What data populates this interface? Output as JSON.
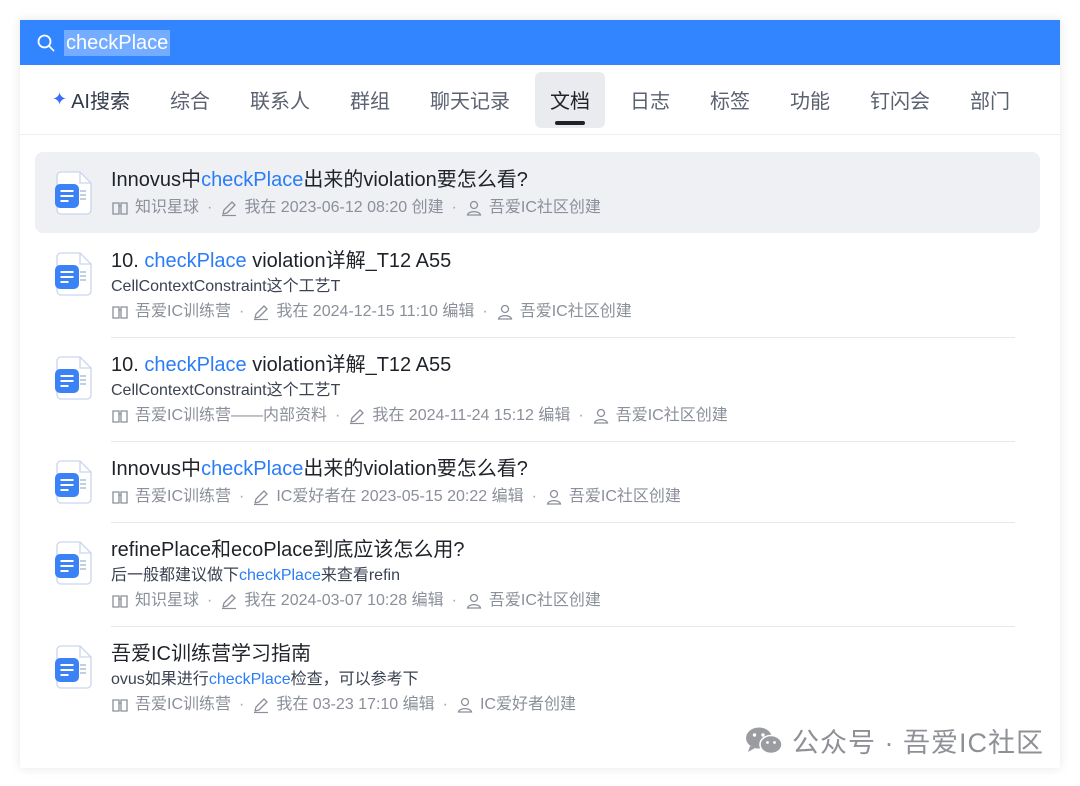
{
  "search": {
    "query": "checkPlace"
  },
  "tabs": [
    {
      "label": "AI搜索"
    },
    {
      "label": "综合"
    },
    {
      "label": "联系人"
    },
    {
      "label": "群组"
    },
    {
      "label": "聊天记录"
    },
    {
      "label": "文档"
    },
    {
      "label": "日志"
    },
    {
      "label": "标签"
    },
    {
      "label": "功能"
    },
    {
      "label": "钉闪会"
    },
    {
      "label": "部门"
    }
  ],
  "results": [
    {
      "title_pre": "Innovus中",
      "title_hl": "checkPlace",
      "title_post": "出来的violation要怎么看?",
      "snippet_pre": "",
      "snippet_hl": "",
      "snippet_post": "",
      "space": "知识星球",
      "editor": "我在 2023-06-12 08:20 创建",
      "owner": "吾爱IC社区创建"
    },
    {
      "title_pre": "10. ",
      "title_hl": "checkPlace",
      "title_post": " violation详解_T12 A55",
      "snippet_pre": "CellContextConstraint这个工艺T",
      "snippet_hl": "",
      "snippet_post": "",
      "space": "吾爱IC训练营",
      "editor": "我在 2024-12-15 11:10 编辑",
      "owner": "吾爱IC社区创建"
    },
    {
      "title_pre": "10. ",
      "title_hl": "checkPlace",
      "title_post": " violation详解_T12 A55",
      "snippet_pre": "CellContextConstraint这个工艺T",
      "snippet_hl": "",
      "snippet_post": "",
      "space": "吾爱IC训练营——内部资料",
      "editor": "我在 2024-11-24 15:12 编辑",
      "owner": "吾爱IC社区创建"
    },
    {
      "title_pre": "Innovus中",
      "title_hl": "checkPlace",
      "title_post": "出来的violation要怎么看?",
      "snippet_pre": "",
      "snippet_hl": "",
      "snippet_post": "",
      "space": "吾爱IC训练营",
      "editor": "IC爱好者在 2023-05-15 20:22 编辑",
      "owner": "吾爱IC社区创建"
    },
    {
      "title_pre": "refinePlace和ecoPlace到底应该怎么用?",
      "title_hl": "",
      "title_post": "",
      "snippet_pre": "后一般都建议做下",
      "snippet_hl": "checkPlace",
      "snippet_post": "来查看refin",
      "space": "知识星球",
      "editor": "我在 2024-03-07 10:28 编辑",
      "owner": "吾爱IC社区创建"
    },
    {
      "title_pre": "吾爱IC训练营学习指南",
      "title_hl": "",
      "title_post": "",
      "snippet_pre": "ovus如果进行",
      "snippet_hl": "checkPlace",
      "snippet_post": "检查，可以参考下",
      "space": "吾爱IC训练营",
      "editor": "我在 03-23 17:10 编辑",
      "owner": "IC爱好者创建"
    }
  ],
  "meta_separator": "·",
  "watermark": {
    "text": "公众号 · 吾爱IC社区"
  },
  "colors": {
    "header_bar": "#3385ff",
    "highlight": "#2a7df6",
    "doc_icon": "#3b82f6"
  },
  "icons": {
    "search": "search-icon",
    "doc": "document-icon",
    "space": "book-icon",
    "editor": "pencil-icon",
    "owner": "person-icon",
    "watermark": "wechat-icon"
  }
}
